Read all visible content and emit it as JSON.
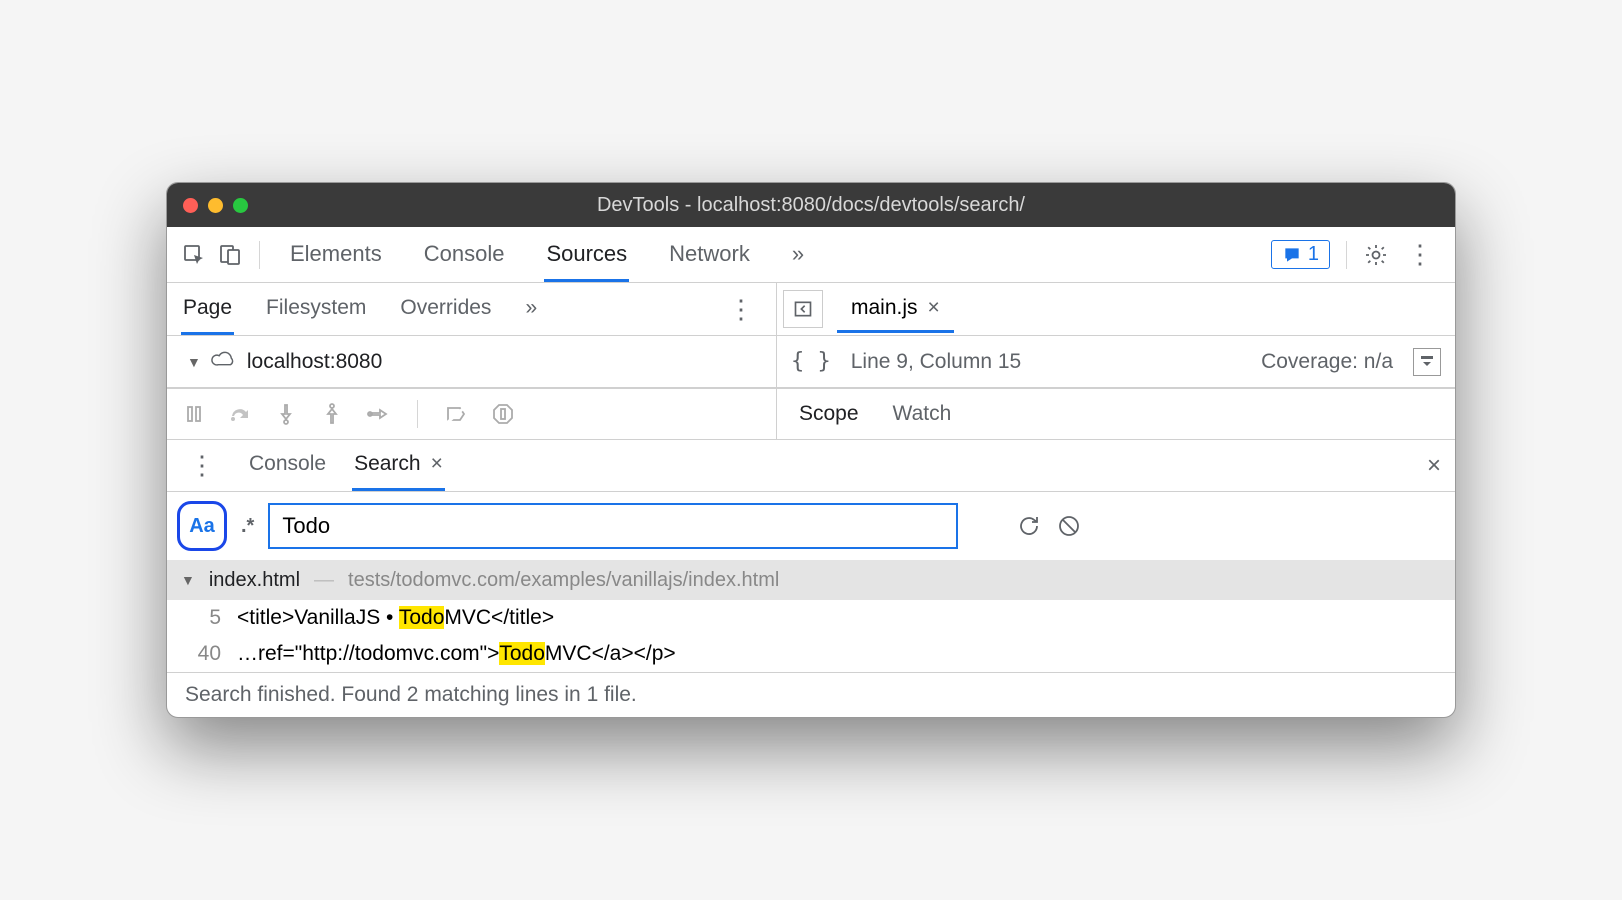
{
  "window": {
    "title": "DevTools - localhost:8080/docs/devtools/search/"
  },
  "main_tabs": {
    "t1": "Elements",
    "t2": "Console",
    "t3": "Sources",
    "t4": "Network",
    "more": "»"
  },
  "feedback": {
    "count": "1"
  },
  "sources_tabs": {
    "t1": "Page",
    "t2": "Filesystem",
    "t3": "Overrides",
    "more": "»"
  },
  "file_tree": {
    "host": "localhost:8080"
  },
  "open_file": {
    "name": "main.js"
  },
  "editor_status": {
    "braces": "{ }",
    "position": "Line 9, Column 15",
    "coverage": "Coverage: n/a"
  },
  "scope_tabs": {
    "t1": "Scope",
    "t2": "Watch"
  },
  "drawer": {
    "t1": "Console",
    "t2": "Search"
  },
  "search": {
    "case": "Aa",
    "regex": ".*",
    "value": "Todo"
  },
  "result_file": {
    "name": "index.html",
    "path": "tests/todomvc.com/examples/vanillajs/index.html"
  },
  "result_lines": {
    "l1_no": "5",
    "l1_a": "<title>VanillaJS • ",
    "l1_hl": "Todo",
    "l1_b": "MVC</title>",
    "l2_no": "40",
    "l2_a": "…ref=\"http://todomvc.com\">",
    "l2_hl": "Todo",
    "l2_b": "MVC</a></p>"
  },
  "footer": "Search finished.  Found 2 matching lines in 1 file."
}
